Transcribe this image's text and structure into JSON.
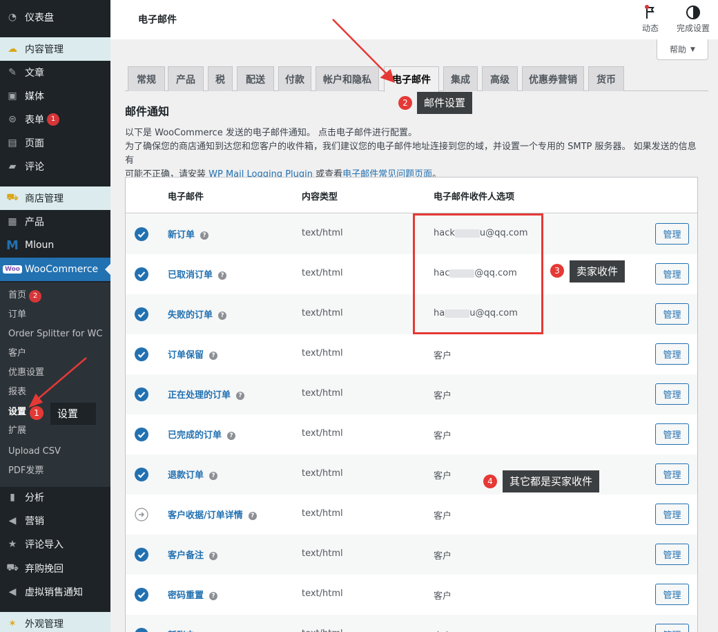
{
  "sidebar": {
    "items": [
      {
        "label": "仪表盘",
        "icon": "dashboard-icon"
      },
      {
        "label": "内容管理",
        "icon": "cloud-icon",
        "section": true
      },
      {
        "label": "文章",
        "icon": "pin-icon"
      },
      {
        "label": "媒体",
        "icon": "media-icon"
      },
      {
        "label": "表单",
        "icon": "form-icon",
        "badge": "1"
      },
      {
        "label": "页面",
        "icon": "page-icon"
      },
      {
        "label": "评论",
        "icon": "comment-icon"
      },
      {
        "label": "商店管理",
        "icon": "cart-icon",
        "section": true
      },
      {
        "label": "产品",
        "icon": "archive-icon"
      },
      {
        "label": "Mloun",
        "icon": "mloun-logo-icon"
      },
      {
        "label": "WooCommerce",
        "icon": "woo-logo-icon",
        "active": true
      },
      {
        "label": "分析",
        "icon": "chart-icon"
      },
      {
        "label": "营销",
        "icon": "megaphone-icon"
      },
      {
        "label": "评论导入",
        "icon": "star-icon"
      },
      {
        "label": "弃购挽回",
        "icon": "cart-icon"
      },
      {
        "label": "虚拟销售通知",
        "icon": "megaphone-icon"
      },
      {
        "label": "外观管理",
        "icon": "palm-icon",
        "section": true
      }
    ],
    "submenu": [
      {
        "label": "首页",
        "badge": "2"
      },
      {
        "label": "订单"
      },
      {
        "label": "Order Splitter for WC"
      },
      {
        "label": "客户"
      },
      {
        "label": "优惠设置"
      },
      {
        "label": "报表"
      },
      {
        "label": "设置",
        "current": true
      },
      {
        "label": "扩展"
      },
      {
        "label": "Upload CSV"
      },
      {
        "label": "PDF发票"
      }
    ]
  },
  "topbar": {
    "title": "电子邮件",
    "activity_label": "动态",
    "setup_label": "完成设置",
    "help_label": "帮助"
  },
  "tabs": [
    "常规",
    "产品",
    "税",
    "配送",
    "付款",
    "帐户和隐私",
    "电子邮件",
    "集成",
    "高级",
    "优惠券营销",
    "货币"
  ],
  "active_tab": "电子邮件",
  "section": {
    "title": "邮件通知",
    "desc_line1": "以下是 WooCommerce 发送的电子邮件通知。 点击电子邮件进行配置。",
    "desc_line2": "为了确保您的商店通知到达您和您客户的收件箱，我们建议您的电子邮件地址连接到您的域，并设置一个专用的 SMTP 服务器。 如果发送的信息有",
    "desc_line3_pre": "可能不正确，请安装 ",
    "desc_link1": "WP Mail Logging Plugin",
    "desc_mid": " 或查看",
    "desc_link2": "电子邮件常见问题页面",
    "desc_end": "。"
  },
  "table": {
    "headers": {
      "email": "电子邮件",
      "content_type": "内容类型",
      "recipient": "电子邮件收件人选项"
    },
    "manage_label": "管理",
    "rows": [
      {
        "name": "新订单",
        "type": "text/html",
        "recip_pre": "hack",
        "recip_post": "u@qq.com",
        "status": "enabled"
      },
      {
        "name": "已取消订单",
        "type": "text/html",
        "recip_pre": "hac",
        "recip_post": "@qq.com",
        "status": "enabled"
      },
      {
        "name": "失败的订单",
        "type": "text/html",
        "recip_pre": "ha",
        "recip_post": "u@qq.com",
        "status": "enabled"
      },
      {
        "name": "订单保留",
        "type": "text/html",
        "recipient": "客户",
        "status": "enabled"
      },
      {
        "name": "正在处理的订单",
        "type": "text/html",
        "recipient": "客户",
        "status": "enabled"
      },
      {
        "name": "已完成的订单",
        "type": "text/html",
        "recipient": "客户",
        "status": "enabled"
      },
      {
        "name": "退款订单",
        "type": "text/html",
        "recipient": "客户",
        "status": "enabled"
      },
      {
        "name": "客户收据/订单详情",
        "type": "text/html",
        "recipient": "客户",
        "status": "manual"
      },
      {
        "name": "客户备注",
        "type": "text/html",
        "recipient": "客户",
        "status": "enabled"
      },
      {
        "name": "密码重置",
        "type": "text/html",
        "recipient": "客户",
        "status": "enabled"
      },
      {
        "name": "新账户",
        "type": "text/html",
        "recipient": "客户",
        "status": "enabled"
      }
    ]
  },
  "annotations": {
    "n1": "1",
    "l1": "设置",
    "n2": "2",
    "l2": "邮件设置",
    "n3": "3",
    "l3": "卖家收件",
    "n4": "4",
    "l4": "其它都是买家收件"
  },
  "colors": {
    "accent": "#2271b1",
    "sidebar": "#1d2327",
    "annotation_red": "#e53935"
  }
}
